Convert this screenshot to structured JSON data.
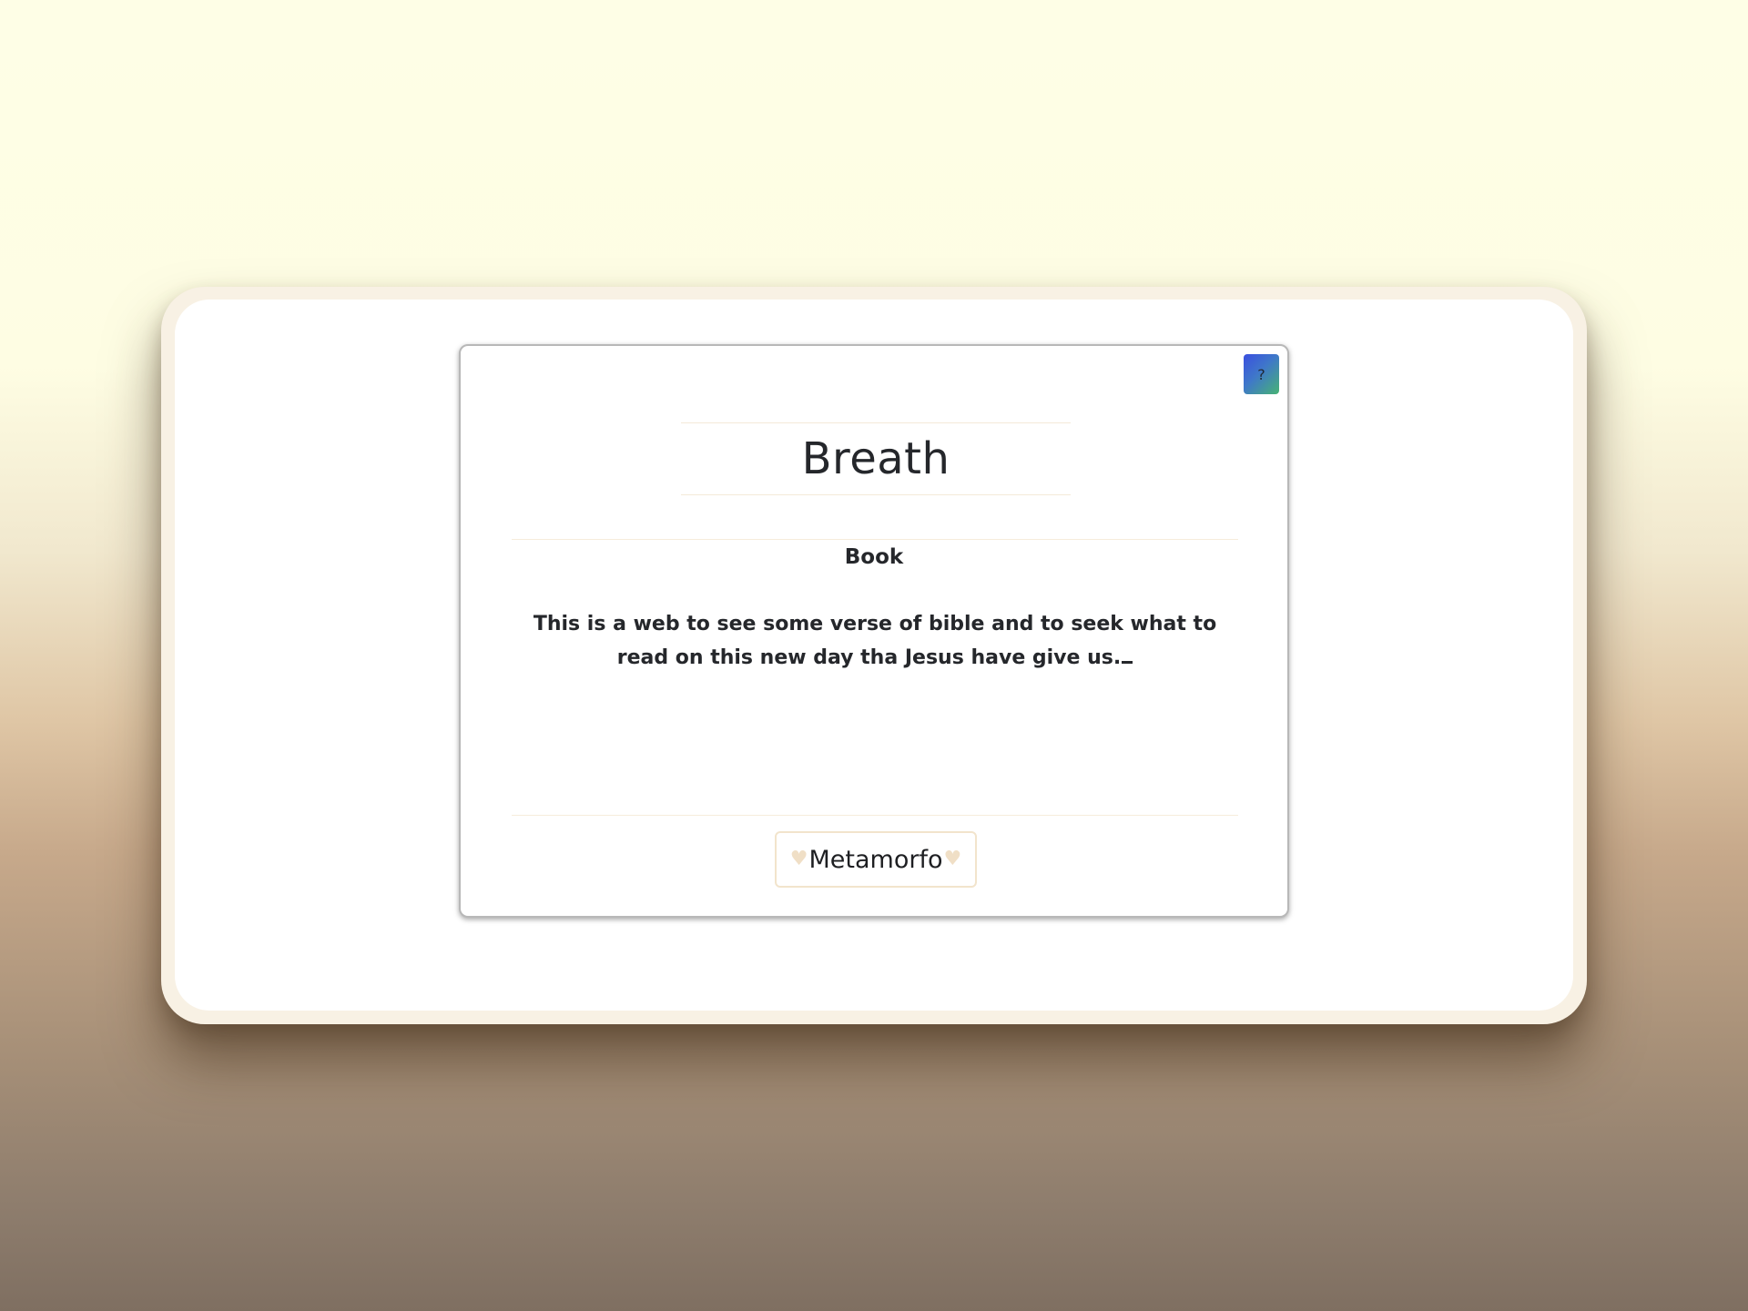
{
  "card": {
    "help_label": "?",
    "title": "Breath",
    "subtitle": "Book",
    "description": "This is a web to see some verse of bible and to seek what to read on this new day tha Jesus have give us.",
    "footer": {
      "label": "Metamorfo",
      "left_icon": "heart-icon",
      "right_icon": "heart-icon",
      "heart_glyph": "♥"
    }
  },
  "colors": {
    "heart": "#f0dfc6",
    "help_gradient_start": "#3a4fe0",
    "help_gradient_end": "#47b374"
  }
}
